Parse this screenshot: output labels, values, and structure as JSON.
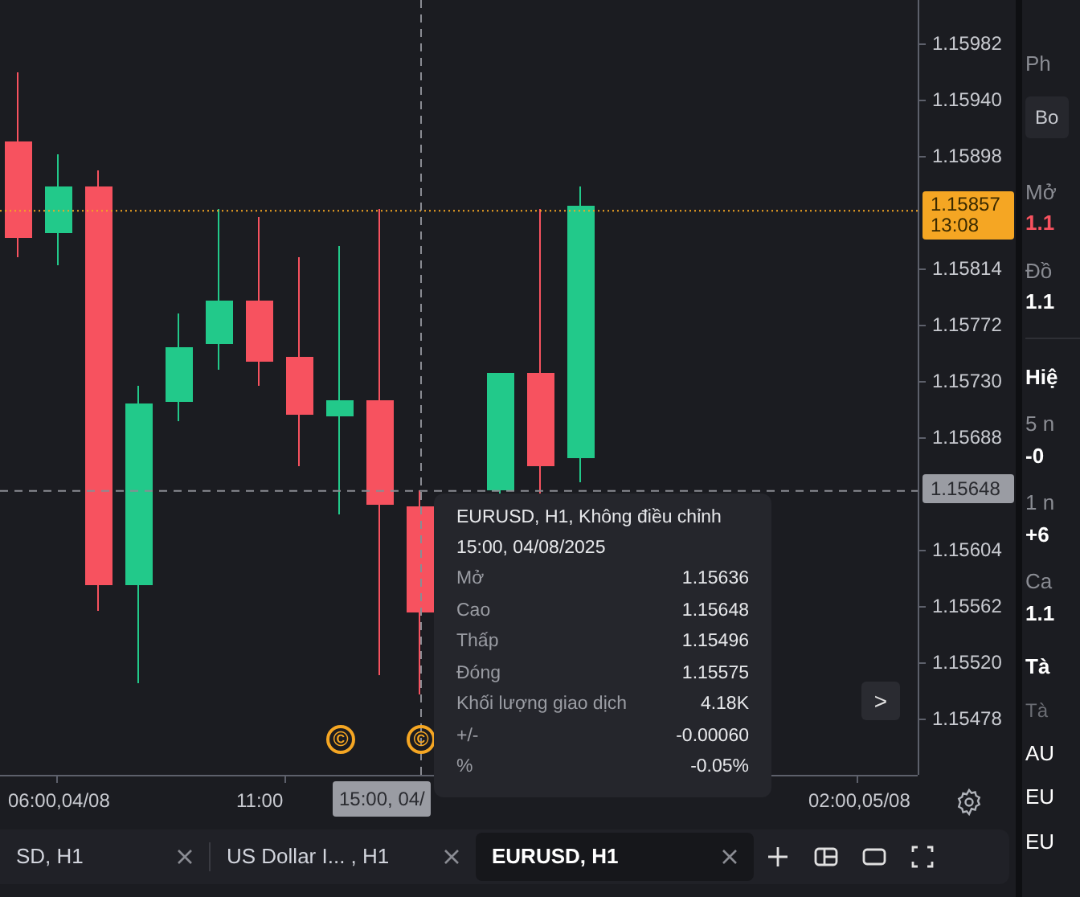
{
  "chart": {
    "price_ticks": [
      "1.15982",
      "1.15940",
      "1.15898",
      "1.15814",
      "1.15772",
      "1.15730",
      "1.15688",
      "1.15604",
      "1.15562",
      "1.15520",
      "1.15478"
    ],
    "last_price": {
      "price": "1.15857",
      "countdown": "13:08"
    },
    "crosshair": {
      "price": "1.15648",
      "time": "15:00, 04/"
    },
    "time_ticks": [
      "06:00,04/08",
      "11:00",
      "02:00,05/08"
    ],
    "event_markers": [
      "©",
      "©"
    ],
    "scroll_button": ">",
    "tooltip": {
      "title": "EURUSD, H1, Không điều chỉnh",
      "time": "15:00, 04/08/2025",
      "rows": [
        {
          "label": "Mở",
          "value": "1.15636"
        },
        {
          "label": "Cao",
          "value": "1.15648"
        },
        {
          "label": "Thấp",
          "value": "1.15496"
        },
        {
          "label": "Đóng",
          "value": "1.15575"
        },
        {
          "label": "Khối lượng giao dịch",
          "value": "4.18K"
        },
        {
          "label": "+/-",
          "value": "-0.00060"
        },
        {
          "label": "%",
          "value": "-0.05%"
        }
      ]
    }
  },
  "tabs": [
    {
      "label": "SD, H1",
      "selected": false
    },
    {
      "label": "US Dollar I... , H1",
      "selected": false
    },
    {
      "label": "EURUSD, H1",
      "selected": true
    }
  ],
  "side_panel": [
    {
      "kind": "label",
      "text": "Ph"
    },
    {
      "kind": "button",
      "text": "Bo"
    },
    {
      "kind": "label",
      "text": "Mở"
    },
    {
      "kind": "down",
      "text": "1.1"
    },
    {
      "kind": "label",
      "text": "Đồ"
    },
    {
      "kind": "value",
      "text": "1.1"
    },
    {
      "kind": "divider"
    },
    {
      "kind": "heading",
      "text": "Hiệ"
    },
    {
      "kind": "label",
      "text": "5 n"
    },
    {
      "kind": "value",
      "text": "-0"
    },
    {
      "kind": "label",
      "text": "1 n"
    },
    {
      "kind": "value",
      "text": "+6"
    },
    {
      "kind": "label",
      "text": "Ca"
    },
    {
      "kind": "value",
      "text": "1.1"
    },
    {
      "kind": "heading",
      "text": "Tà"
    },
    {
      "kind": "muted",
      "text": "Tà"
    },
    {
      "kind": "item",
      "text": "AU"
    },
    {
      "kind": "item",
      "text": "EU"
    },
    {
      "kind": "item",
      "text": "EU"
    }
  ]
}
